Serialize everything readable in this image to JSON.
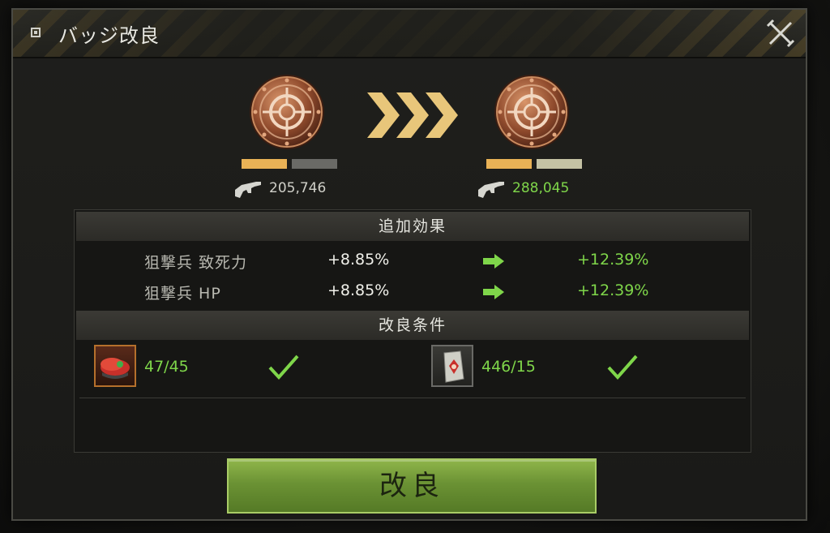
{
  "dialog": {
    "title": "バッジ改良",
    "close_icon": "close-x-icon"
  },
  "badge_current": {
    "icon": "crosshair-bronze-badge-icon",
    "stat_icon": "rifle-icon",
    "power": "205,746",
    "power_color": "#cfcfc8",
    "level_fill": 0.5
  },
  "badge_next": {
    "icon": "crosshair-bronze-badge-icon",
    "stat_icon": "rifle-icon",
    "power": "288,045",
    "power_color": "#7fd64a",
    "level_fill": 0.5
  },
  "arrow_icon": "triple-chevron-right-icon",
  "effects": {
    "heading": "追加効果",
    "rows": [
      {
        "name": "狙撃兵 致死力",
        "current": "+8.85%",
        "next": "+12.39%"
      },
      {
        "name": "狙撃兵 HP",
        "current": "+8.85%",
        "next": "+12.39%"
      }
    ]
  },
  "requirements": {
    "heading": "改良条件",
    "items": [
      {
        "icon": "red-beret-icon",
        "count": "47/45",
        "met": true
      },
      {
        "icon": "medal-badge-icon",
        "count": "446/15",
        "met": true
      }
    ]
  },
  "upgrade_button": {
    "label": "改良"
  },
  "colors": {
    "accent_green": "#7fd64a",
    "bar_orange": "#e9b256",
    "chevron_gold": "#e8c67a"
  }
}
